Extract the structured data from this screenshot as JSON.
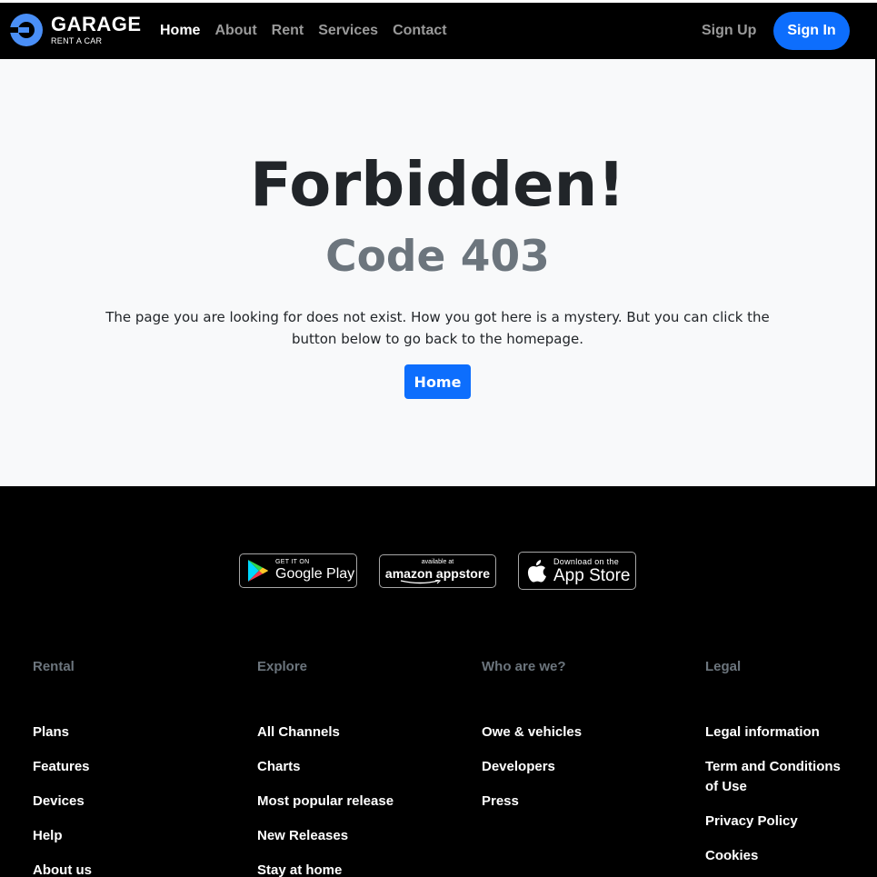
{
  "brand": {
    "name": "GARAGE",
    "tagline": "RENT A CAR"
  },
  "nav": {
    "links": [
      "Home",
      "About",
      "Rent",
      "Services",
      "Contact"
    ],
    "active": "Home",
    "signup": "Sign Up",
    "signin": "Sign In"
  },
  "main": {
    "title": "Forbidden!",
    "code": "Code 403",
    "message": "The page you are looking for does not exist. How you got here is a mystery. But you can click the button below to go back to the homepage.",
    "button": "Home"
  },
  "stores": {
    "google": {
      "small": "GET IT ON",
      "big": "Google Play"
    },
    "amazon": {
      "small": "available at",
      "big": "amazon appstore"
    },
    "apple": {
      "small": "Download on the",
      "big": "App Store"
    }
  },
  "footer": {
    "columns": [
      {
        "heading": "Rental",
        "items": [
          "Plans",
          "Features",
          "Devices",
          "Help",
          "About us"
        ]
      },
      {
        "heading": "Explore",
        "items": [
          "All Channels",
          "Charts",
          "Most popular release",
          "New Releases",
          "Stay at home"
        ]
      },
      {
        "heading": "Who are we?",
        "items": [
          "Owe & vehicles",
          "Developers",
          "Press"
        ]
      },
      {
        "heading": "Legal",
        "items": [
          "Legal information",
          "Term and Conditions of Use",
          "Privacy Policy",
          "Cookies"
        ]
      }
    ]
  },
  "colors": {
    "accent": "#0d6efd",
    "background": "#000000",
    "content": "#f8f9fa",
    "muted": "#6c757d"
  }
}
